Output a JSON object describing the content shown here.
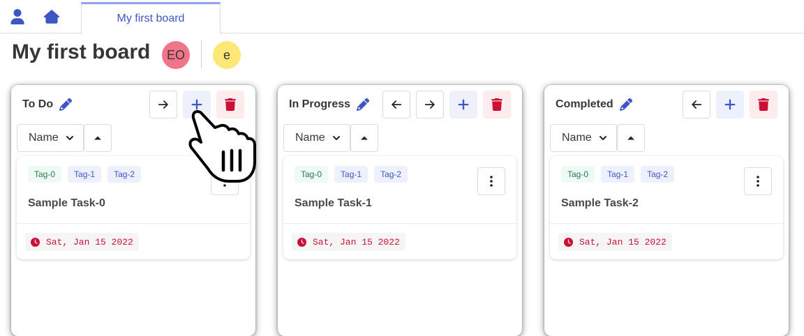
{
  "nav": {
    "user_icon": "user-icon",
    "home_icon": "home-icon",
    "tab_label": "My first board"
  },
  "board": {
    "title": "My first board",
    "members": [
      {
        "initials": "EO",
        "color": "#f1758a"
      },
      {
        "initials": "e",
        "color": "#fde776"
      }
    ]
  },
  "colors": {
    "accent": "#3e56c4",
    "danger": "#cc0f35",
    "tag_green_text": "#257953"
  },
  "columns": [
    {
      "title": "To Do",
      "sort_field": "Name",
      "card": {
        "tags": [
          "Tag-0",
          "Tag-1",
          "Tag-2"
        ],
        "name": "Sample Task-0",
        "due": "Sat, Jan 15 2022"
      }
    },
    {
      "title": "In Progress",
      "sort_field": "Name",
      "card": {
        "tags": [
          "Tag-0",
          "Tag-1",
          "Tag-2"
        ],
        "name": "Sample Task-1",
        "due": "Sat, Jan 15 2022"
      }
    },
    {
      "title": "Completed",
      "sort_field": "Name",
      "card": {
        "tags": [
          "Tag-0",
          "Tag-1",
          "Tag-2"
        ],
        "name": "Sample Task-2",
        "due": "Sat, Jan 15 2022"
      }
    }
  ]
}
